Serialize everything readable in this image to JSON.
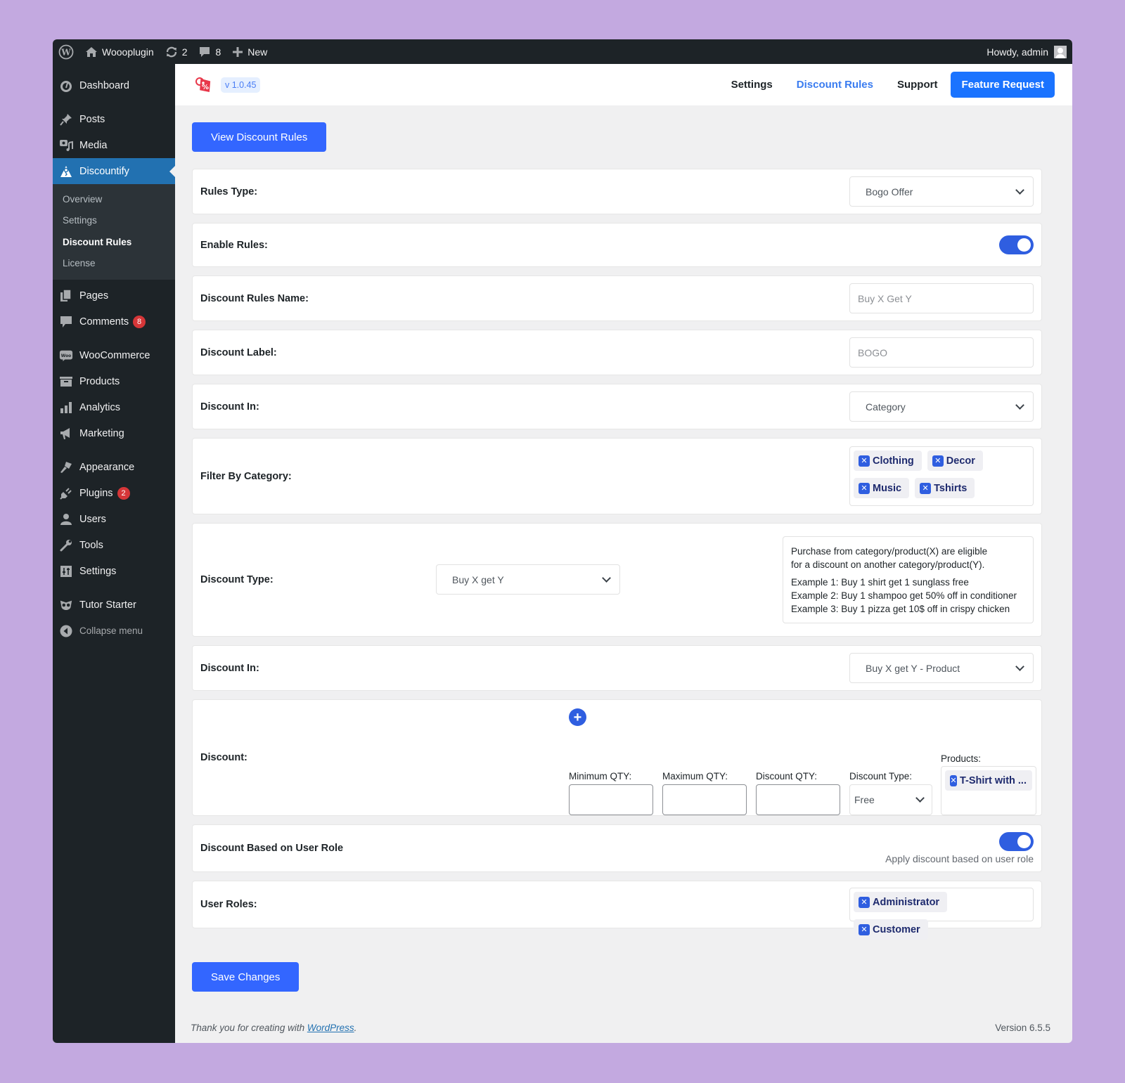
{
  "admin_bar": {
    "site_name": "Woooplugin",
    "updates_count": "2",
    "comments_count": "8",
    "new_label": "New",
    "greeting": "Howdy, admin"
  },
  "sidebar": {
    "items": [
      {
        "label": "Dashboard",
        "icon": "dashboard-icon"
      },
      {
        "label": "Posts",
        "icon": "pin-icon"
      },
      {
        "label": "Media",
        "icon": "media-icon"
      },
      {
        "label": "Discountify",
        "icon": "discountify-icon",
        "active": true
      },
      {
        "label": "Pages",
        "icon": "pages-icon"
      },
      {
        "label": "Comments",
        "icon": "comment-icon",
        "badge": "8"
      },
      {
        "label": "WooCommerce",
        "icon": "woo-icon"
      },
      {
        "label": "Products",
        "icon": "archive-icon"
      },
      {
        "label": "Analytics",
        "icon": "bar-chart-icon"
      },
      {
        "label": "Marketing",
        "icon": "megaphone-icon"
      },
      {
        "label": "Appearance",
        "icon": "brush-icon"
      },
      {
        "label": "Plugins",
        "icon": "plug-icon",
        "badge": "2"
      },
      {
        "label": "Users",
        "icon": "user-icon"
      },
      {
        "label": "Tools",
        "icon": "wrench-icon"
      },
      {
        "label": "Settings",
        "icon": "sliders-icon"
      },
      {
        "label": "Tutor Starter",
        "icon": "owl-icon"
      },
      {
        "label": "Collapse menu",
        "icon": "collapse-icon"
      }
    ],
    "submenu": [
      "Overview",
      "Settings",
      "Discount Rules",
      "License"
    ],
    "submenu_current": "Discount Rules"
  },
  "plugin_header": {
    "version": "v 1.0.45",
    "nav": [
      "Settings",
      "Discount Rules",
      "Support"
    ],
    "nav_active": "Discount Rules",
    "feature_request": "Feature Request"
  },
  "main": {
    "view_rules_button": "View Discount Rules",
    "rules_type": {
      "label": "Rules Type:",
      "value": "Bogo Offer"
    },
    "enable_rules": {
      "label": "Enable Rules:",
      "enabled": true
    },
    "rules_name": {
      "label": "Discount Rules Name:",
      "value": "Buy X Get Y"
    },
    "discount_label": {
      "label": "Discount Label:",
      "value": "BOGO"
    },
    "discount_in": {
      "label": "Discount In:",
      "value": "Category"
    },
    "filter_category": {
      "label": "Filter By Category:",
      "tags": [
        "Clothing",
        "Decor",
        "Music",
        "Tshirts"
      ]
    },
    "discount_type": {
      "label": "Discount Type:",
      "value": "Buy X get Y",
      "info_line1": "Purchase from category/product(X) are eligible",
      "info_line2": "for a discount on another category/product(Y).",
      "examples": [
        "Example 1: Buy 1 shirt get 1 sunglass free",
        "Example 2: Buy 1 shampoo get 50% off in conditioner",
        "Example 3: Buy 1 pizza get 10$ off in crispy chicken"
      ]
    },
    "discount_in_2": {
      "label": "Discount In:",
      "value": "Buy X get Y - Product"
    },
    "discount": {
      "label": "Discount:",
      "min_qty_label": "Minimum QTY:",
      "max_qty_label": "Maximum QTY:",
      "discount_qty_label": "Discount QTY:",
      "min_qty_value": "",
      "max_qty_value": "",
      "discount_qty_value": "",
      "discount_type_label": "Discount Type:",
      "discount_type_value": "Free",
      "products_label": "Products:",
      "products": [
        "T-Shirt with ..."
      ]
    },
    "user_role_toggle": {
      "label": "Discount Based on User Role",
      "enabled": true,
      "help": "Apply discount based on user role"
    },
    "user_roles": {
      "label": "User Roles:",
      "tags": [
        "Administrator",
        "Customer"
      ]
    },
    "save_button": "Save Changes"
  },
  "footer": {
    "thanks_prefix": "Thank you for creating with ",
    "thanks_link": "WordPress",
    "thanks_suffix": ".",
    "version": "Version 6.5.5"
  }
}
